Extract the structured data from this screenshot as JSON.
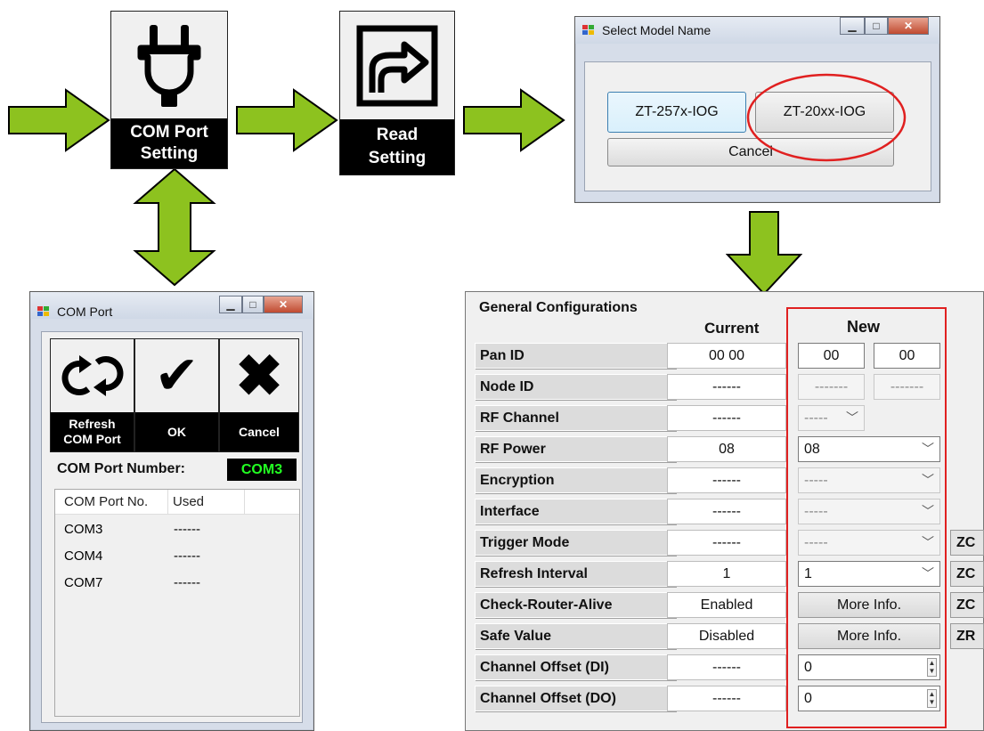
{
  "tiles": {
    "com_port_setting": {
      "label_line1": "COM Port",
      "label_line2": "Setting"
    },
    "read_setting": {
      "label_line1": "Read",
      "label_line2": "Setting"
    }
  },
  "select_model_window": {
    "title": "Select Model Name",
    "buttons": {
      "model_a": "ZT-257x-IOG",
      "model_b": "ZT-20xx-IOG",
      "cancel": "Cancel"
    }
  },
  "com_port_window": {
    "title": "COM Port",
    "toolbar": {
      "refresh_line1": "Refresh",
      "refresh_line2": "COM Port",
      "ok": "OK",
      "cancel": "Cancel"
    },
    "port_number_label": "COM Port Number:",
    "port_number_value": "COM3",
    "list_headers": [
      "COM Port No.",
      "Used"
    ],
    "list_rows": [
      {
        "port": "COM3",
        "used": "------"
      },
      {
        "port": "COM4",
        "used": "------"
      },
      {
        "port": "COM7",
        "used": "------"
      }
    ]
  },
  "general_config": {
    "title": "General Configurations",
    "col_current": "Current",
    "col_new": "New",
    "rows": [
      {
        "label": "Pan ID",
        "current": "00 00",
        "new_a": "00",
        "new_b": "00"
      },
      {
        "label": "Node ID",
        "current": "------",
        "new_a": "-------",
        "new_b": "-------"
      },
      {
        "label": "RF Channel",
        "current": "------",
        "new": "-----"
      },
      {
        "label": "RF Power",
        "current": "08",
        "new": "08"
      },
      {
        "label": "Encryption",
        "current": "------",
        "new": "-----"
      },
      {
        "label": "Interface",
        "current": "------",
        "new": "-----"
      },
      {
        "label": "Trigger Mode",
        "current": "------",
        "new": "-----",
        "side": "ZC"
      },
      {
        "label": "Refresh Interval",
        "current": "1",
        "new": "1",
        "side": "ZC"
      },
      {
        "label": "Check-Router-Alive",
        "current": "Enabled",
        "new": "More Info.",
        "side": "ZC"
      },
      {
        "label": "Safe Value",
        "current": "Disabled",
        "new": "More Info.",
        "side": "ZR"
      },
      {
        "label": "Channel Offset (DI)",
        "current": "------",
        "new": "0"
      },
      {
        "label": "Channel Offset (DO)",
        "current": "------",
        "new": "0"
      }
    ]
  },
  "colors": {
    "arrow_green": "#8dc21f",
    "highlight_red": "#e02020",
    "com_value_green": "#22ff22"
  }
}
